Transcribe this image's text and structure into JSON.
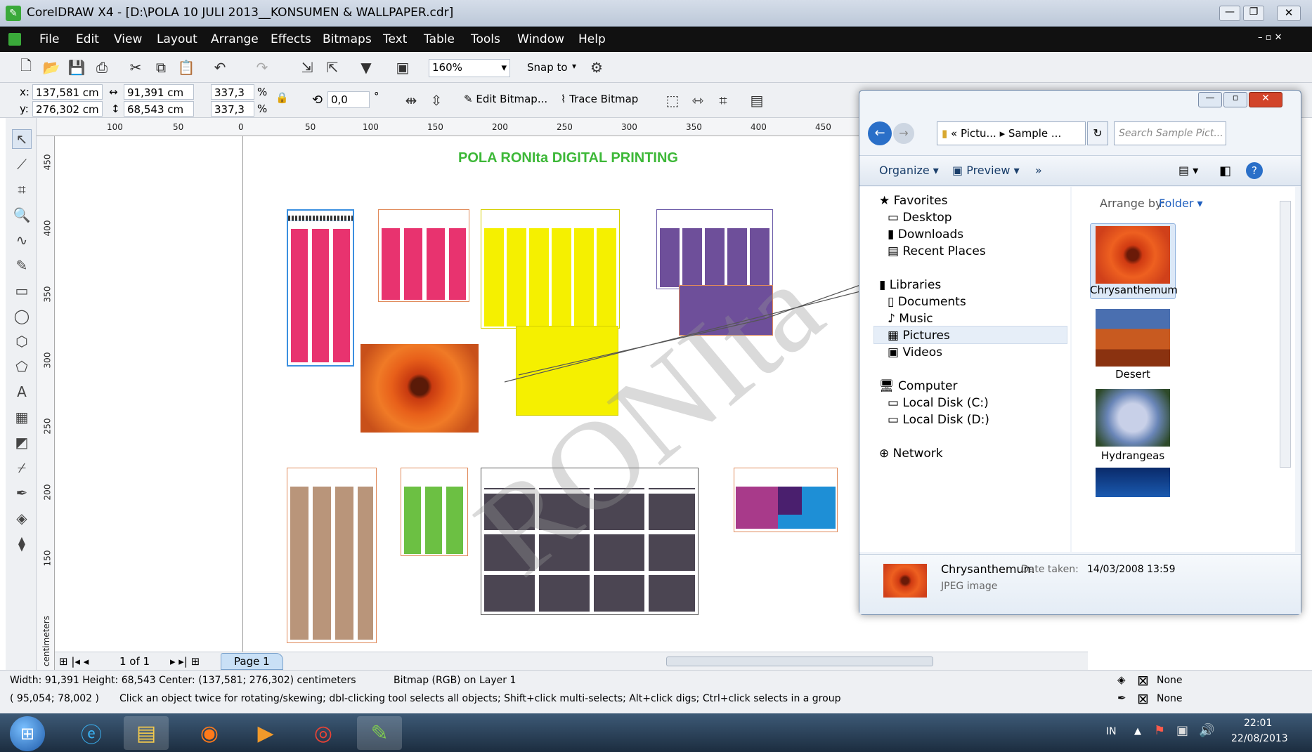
{
  "window": {
    "title": "CorelDRAW X4 - [D:\\POLA 10 JULI 2013__KONSUMEN & WALLPAPER.cdr]"
  },
  "menu": [
    "File",
    "Edit",
    "View",
    "Layout",
    "Arrange",
    "Effects",
    "Bitmaps",
    "Text",
    "Table",
    "Tools",
    "Window",
    "Help"
  ],
  "toolbar": {
    "zoom": "160%",
    "snap_label": "Snap to"
  },
  "propbar": {
    "x": "137,581 cm",
    "y": "276,302 cm",
    "w": "91,391 cm",
    "h": "68,543 cm",
    "sx": "337,3",
    "sy": "337,3",
    "pct": "%",
    "angle": "0,0",
    "deg": "°",
    "edit_bitmap": "Edit Bitmap...",
    "trace_bitmap": "Trace Bitmap",
    "x_lbl": "x:",
    "y_lbl": "y:"
  },
  "ruler": {
    "h": [
      "100",
      "50",
      "0",
      "50",
      "100",
      "150",
      "200",
      "250",
      "300",
      "350",
      "400",
      "450"
    ],
    "v": [
      "450",
      "400",
      "350",
      "300",
      "250",
      "200",
      "150"
    ],
    "unit": "centimeters"
  },
  "canvas": {
    "heading": "POLA RONIta DIGITAL PRINTING",
    "watermark": "RONIta",
    "colors": {
      "pink": "#e8336f",
      "yellow": "#f5f000",
      "purple": "#6e4f9a",
      "tan": "#b9957a",
      "green": "#6cc043",
      "gray": "#4b4552",
      "heading": "#3db838"
    }
  },
  "pagenav": {
    "pages": "1 of 1",
    "tab": "Page 1"
  },
  "status": {
    "line1": "Width: 91,391  Height: 68,543  Center: (137,581; 276,302)  centimeters",
    "layer": "Bitmap (RGB) on Layer 1",
    "coords": "( 95,054; 78,002 )",
    "hint": "Click an object twice for rotating/skewing; dbl-clicking tool selects all objects; Shift+click multi-selects; Alt+click digs; Ctrl+click selects in a group",
    "fill": "None",
    "outline": "None"
  },
  "explorer": {
    "path1": "« Pictu...",
    "path2": "Sample ...",
    "search_placeholder": "Search Sample Pict...",
    "organize": "Organize",
    "preview": "Preview",
    "more": "»",
    "arrange_label": "Arrange by:",
    "arrange_value": "Folder",
    "nav": {
      "favorites": "Favorites",
      "desktop": "Desktop",
      "downloads": "Downloads",
      "recent": "Recent Places",
      "libraries": "Libraries",
      "documents": "Documents",
      "music": "Music",
      "pictures": "Pictures",
      "videos": "Videos",
      "computer": "Computer",
      "disk_c": "Local Disk (C:)",
      "disk_d": "Local Disk (D:)",
      "network": "Network"
    },
    "files": [
      "Chrysanthemum",
      "Desert",
      "Hydrangeas"
    ],
    "details": {
      "name": "Chrysanthemum",
      "date_label": "Date taken:",
      "date": "14/03/2008 13:59",
      "type": "JPEG image"
    }
  },
  "taskbar": {
    "lang": "IN",
    "time": "22:01",
    "date": "22/08/2013"
  }
}
